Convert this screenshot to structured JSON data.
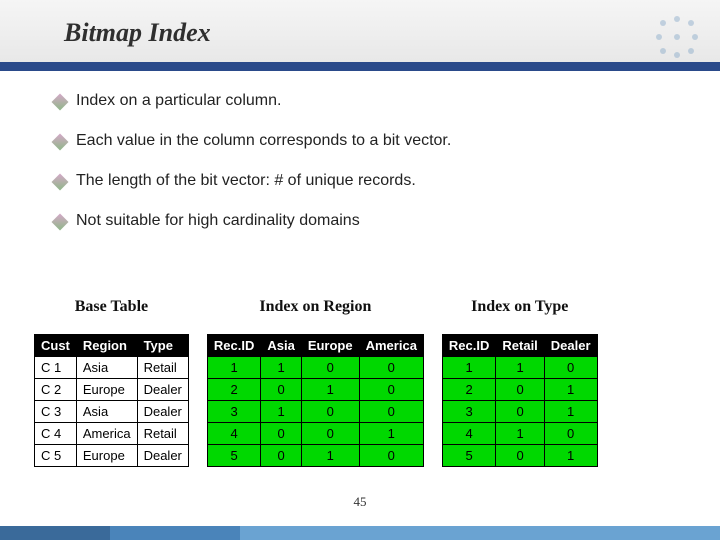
{
  "title": "Bitmap Index",
  "bullets": [
    "Index on a particular column.",
    "Each value in the column corresponds to a bit vector.",
    "The length of the bit vector: # of unique records.",
    "Not suitable for high cardinality domains"
  ],
  "captions": {
    "base": "Base Table",
    "region": "Index on Region",
    "type": "Index on Type"
  },
  "base_table": {
    "headers": [
      "Cust",
      "Region",
      "Type"
    ],
    "rows": [
      [
        "C 1",
        "Asia",
        "Retail"
      ],
      [
        "C 2",
        "Europe",
        "Dealer"
      ],
      [
        "C 3",
        "Asia",
        "Dealer"
      ],
      [
        "C 4",
        "America",
        "Retail"
      ],
      [
        "C 5",
        "Europe",
        "Dealer"
      ]
    ]
  },
  "region_index": {
    "headers": [
      "Rec.ID",
      "Asia",
      "Europe",
      "America"
    ],
    "rows": [
      [
        "1",
        "1",
        "0",
        "0"
      ],
      [
        "2",
        "0",
        "1",
        "0"
      ],
      [
        "3",
        "1",
        "0",
        "0"
      ],
      [
        "4",
        "0",
        "0",
        "1"
      ],
      [
        "5",
        "0",
        "1",
        "0"
      ]
    ]
  },
  "type_index": {
    "headers": [
      "Rec.ID",
      "Retail",
      "Dealer"
    ],
    "rows": [
      [
        "1",
        "1",
        "0"
      ],
      [
        "2",
        "0",
        "1"
      ],
      [
        "3",
        "0",
        "1"
      ],
      [
        "4",
        "1",
        "0"
      ],
      [
        "5",
        "0",
        "1"
      ]
    ]
  },
  "slide_number": "45"
}
